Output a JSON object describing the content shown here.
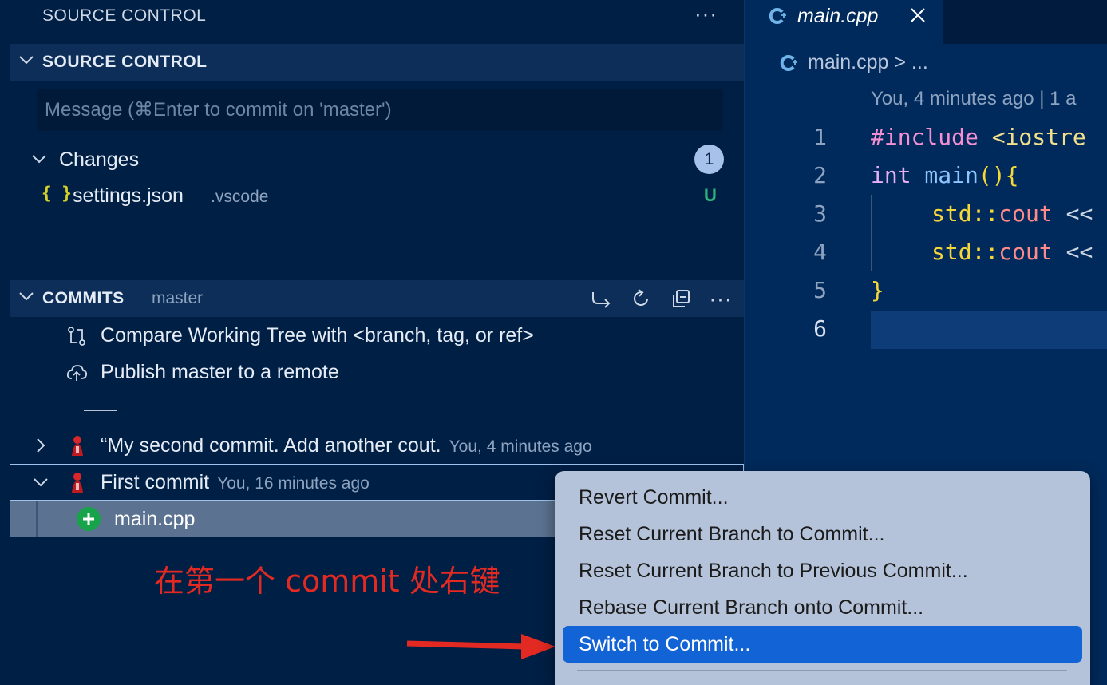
{
  "sidebar": {
    "view_title": "SOURCE CONTROL",
    "view_more": "···",
    "source_control": {
      "title": "SOURCE CONTROL",
      "message_placeholder": "Message (⌘Enter to commit on 'master')",
      "message_value": ""
    },
    "changes": {
      "label": "Changes",
      "count": "1",
      "files": [
        {
          "icon": "{ }",
          "name": "settings.json",
          "dir": ".vscode",
          "status": "U"
        }
      ]
    },
    "commits": {
      "title": "COMMITS",
      "branch": "master",
      "more": "···",
      "actions": [
        {
          "label": "Compare Working Tree with <branch, tag, or ref>"
        },
        {
          "label": "Publish master to a remote"
        }
      ],
      "list": [
        {
          "message": "“My second commit. Add another cout.",
          "meta": "You, 4 minutes ago"
        },
        {
          "message": "First commit",
          "meta": "You, 16 minutes ago",
          "files": [
            {
              "name": "main.cpp"
            }
          ]
        }
      ]
    },
    "annotation": "在第一个 commit 处右键"
  },
  "editor": {
    "tab": {
      "label": "main.cpp"
    },
    "breadcrumb": "main.cpp > ...",
    "blame": "You, 4 minutes ago | 1 a",
    "line_numbers": [
      "1",
      "2",
      "3",
      "4",
      "5",
      "6"
    ],
    "code": {
      "l1_kw": "#include",
      "l1_rest": " <iostre",
      "l2_kw": "int",
      "l2_fn": " main",
      "l2_paren": "()",
      "l2_brace": "{",
      "l3_ns": "std::",
      "l3_cout": "cout",
      "l3_op": " <<",
      "l4_ns": "std::",
      "l4_cout": "cout",
      "l4_op": " <<",
      "l5_brace": "}"
    }
  },
  "context_menu": {
    "items": [
      {
        "label": "Revert Commit..."
      },
      {
        "label": "Reset Current Branch to Commit..."
      },
      {
        "label": "Reset Current Branch to Previous Commit..."
      },
      {
        "label": "Rebase Current Branch onto Commit..."
      },
      {
        "label": "Switch to Commit...",
        "selected": true
      }
    ]
  },
  "colors": {
    "background": "#001f45",
    "editor_background": "#002a5c",
    "menu_background": "#b4c3d9",
    "menu_selected": "#1264d6",
    "annotation": "#e22a22",
    "untracked_status": "#2fb37c",
    "added_icon": "#16a34a"
  }
}
